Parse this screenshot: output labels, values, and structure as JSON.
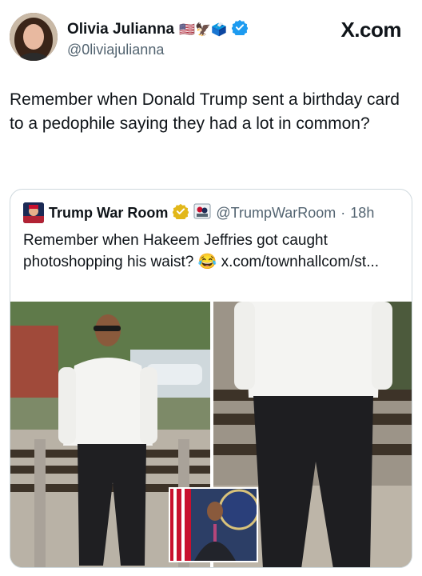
{
  "post": {
    "author_name": "Olivia Julianna",
    "author_emojis": "🇺🇸🦅🗳️",
    "author_handle": "@0liviajulianna",
    "site_label": "X.com",
    "text": "Remember when Donald Trump sent a birthday card to a pedophile saying they had a lot in common?"
  },
  "quoted": {
    "author_name": "Trump War Room",
    "author_handle": "@TrumpWarRoom",
    "separator": "·",
    "time": "18h",
    "text": "Remember when Hakeem Jeffries got caught photoshopping his waist? 😂 x.com/townhallcom/st..."
  },
  "colors": {
    "verified_blue": "#1d9bf0",
    "verified_gold": "#e2b719",
    "text_primary": "#0f1419",
    "text_secondary": "#536471",
    "border": "#cfd9de"
  },
  "icons": {
    "verified": "verified-badge-icon",
    "affiliate": "affiliate-badge-icon"
  }
}
